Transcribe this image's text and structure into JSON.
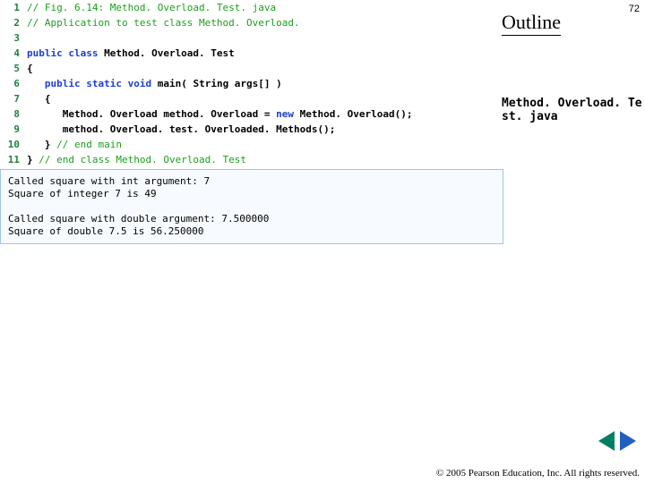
{
  "page_number": "72",
  "outline_label": "Outline",
  "file_label": "Method. Overload. Te\nst. java",
  "code": {
    "lines": [
      {
        "n": "1",
        "tokens": [
          {
            "cls": "tok-comment",
            "t": "// Fig. 6.14: Method. Overload. Test. java"
          }
        ]
      },
      {
        "n": "2",
        "tokens": [
          {
            "cls": "tok-comment",
            "t": "// Application to test class Method. Overload."
          }
        ]
      },
      {
        "n": "3",
        "tokens": []
      },
      {
        "n": "4",
        "tokens": [
          {
            "cls": "tok-keyword",
            "t": "public class "
          },
          {
            "cls": "tok-default",
            "t": "Method. Overload. Test"
          }
        ]
      },
      {
        "n": "5",
        "tokens": [
          {
            "cls": "tok-default",
            "t": "{"
          }
        ]
      },
      {
        "n": "6",
        "tokens": [
          {
            "cls": "tok-default",
            "t": "   "
          },
          {
            "cls": "tok-keyword",
            "t": "public static void "
          },
          {
            "cls": "tok-default",
            "t": "main( String args[] )"
          }
        ]
      },
      {
        "n": "7",
        "tokens": [
          {
            "cls": "tok-default",
            "t": "   {"
          }
        ]
      },
      {
        "n": "8",
        "tokens": [
          {
            "cls": "tok-default",
            "t": "      Method. Overload method. Overload = "
          },
          {
            "cls": "tok-keyword",
            "t": "new "
          },
          {
            "cls": "tok-default",
            "t": "Method. Overload();"
          }
        ]
      },
      {
        "n": "9",
        "tokens": [
          {
            "cls": "tok-default",
            "t": "      method. Overload. test. Overloaded. Methods();"
          }
        ]
      },
      {
        "n": "10",
        "tokens": [
          {
            "cls": "tok-default",
            "t": "   } "
          },
          {
            "cls": "tok-comment",
            "t": "// end main"
          }
        ]
      },
      {
        "n": "11",
        "tokens": [
          {
            "cls": "tok-default",
            "t": "} "
          },
          {
            "cls": "tok-comment",
            "t": "// end class Method. Overload. Test"
          }
        ]
      }
    ]
  },
  "output": "Called square with int argument: 7\nSquare of integer 7 is 49\n\nCalled square with double argument: 7.500000\nSquare of double 7.5 is 56.250000",
  "copyright": "© 2005 Pearson Education,\nInc.  All rights reserved."
}
